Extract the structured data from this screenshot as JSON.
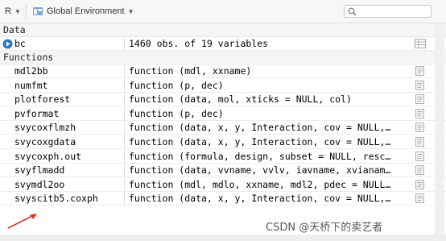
{
  "toolbar": {
    "language": "R",
    "environment": "Global Environment",
    "search_placeholder": ""
  },
  "sections": {
    "data": "Data",
    "functions": "Functions"
  },
  "data_rows": [
    {
      "name": "bc",
      "value": "1460 obs. of 19 variables"
    }
  ],
  "function_rows": [
    {
      "name": "mdl2bb",
      "value": "function (mdl, xxname)"
    },
    {
      "name": "numfmt",
      "value": "function (p, dec)"
    },
    {
      "name": "plotforest",
      "value": "function (data, mol, xticks = NULL, col)"
    },
    {
      "name": "pvformat",
      "value": "function (p, dec)"
    },
    {
      "name": "svycoxflmzh",
      "value": "function (data, x, y, Interaction, cov = NULL,…"
    },
    {
      "name": "svycoxgdata",
      "value": "function (data, x, y, Interaction, cov = NULL,…"
    },
    {
      "name": "svycoxph.out",
      "value": "function (formula, design, subset = NULL, resc…"
    },
    {
      "name": "svyflmadd",
      "value": "function (data, vvname, vvlv, iavname, xvianam…"
    },
    {
      "name": "svymdl2oo",
      "value": "function (mdl, mdlo, xxname, mdl2, pdec = NULL…"
    },
    {
      "name": "svyscitb5.coxph",
      "value": "function (data, x, y, Interaction, cov = NULL,…"
    }
  ],
  "watermark": "CSDN @天桥下的卖艺者",
  "colors": {
    "accent_blue": "#2f7bc2",
    "arrow_red": "#e0302a"
  }
}
